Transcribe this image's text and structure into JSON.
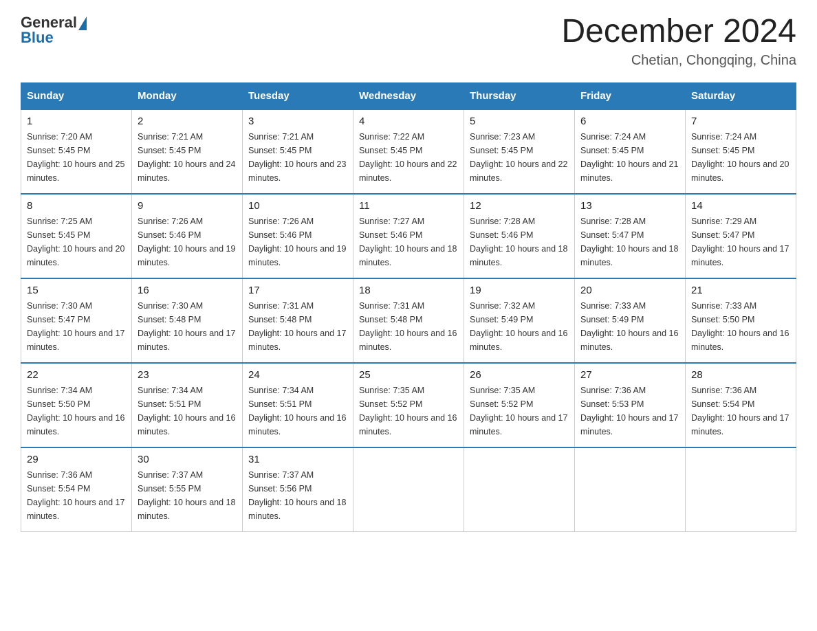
{
  "header": {
    "logo_general": "General",
    "logo_blue": "Blue",
    "month_year": "December 2024",
    "location": "Chetian, Chongqing, China"
  },
  "days_of_week": [
    "Sunday",
    "Monday",
    "Tuesday",
    "Wednesday",
    "Thursday",
    "Friday",
    "Saturday"
  ],
  "weeks": [
    [
      {
        "day": "1",
        "sunrise": "7:20 AM",
        "sunset": "5:45 PM",
        "daylight": "10 hours and 25 minutes."
      },
      {
        "day": "2",
        "sunrise": "7:21 AM",
        "sunset": "5:45 PM",
        "daylight": "10 hours and 24 minutes."
      },
      {
        "day": "3",
        "sunrise": "7:21 AM",
        "sunset": "5:45 PM",
        "daylight": "10 hours and 23 minutes."
      },
      {
        "day": "4",
        "sunrise": "7:22 AM",
        "sunset": "5:45 PM",
        "daylight": "10 hours and 22 minutes."
      },
      {
        "day": "5",
        "sunrise": "7:23 AM",
        "sunset": "5:45 PM",
        "daylight": "10 hours and 22 minutes."
      },
      {
        "day": "6",
        "sunrise": "7:24 AM",
        "sunset": "5:45 PM",
        "daylight": "10 hours and 21 minutes."
      },
      {
        "day": "7",
        "sunrise": "7:24 AM",
        "sunset": "5:45 PM",
        "daylight": "10 hours and 20 minutes."
      }
    ],
    [
      {
        "day": "8",
        "sunrise": "7:25 AM",
        "sunset": "5:45 PM",
        "daylight": "10 hours and 20 minutes."
      },
      {
        "day": "9",
        "sunrise": "7:26 AM",
        "sunset": "5:46 PM",
        "daylight": "10 hours and 19 minutes."
      },
      {
        "day": "10",
        "sunrise": "7:26 AM",
        "sunset": "5:46 PM",
        "daylight": "10 hours and 19 minutes."
      },
      {
        "day": "11",
        "sunrise": "7:27 AM",
        "sunset": "5:46 PM",
        "daylight": "10 hours and 18 minutes."
      },
      {
        "day": "12",
        "sunrise": "7:28 AM",
        "sunset": "5:46 PM",
        "daylight": "10 hours and 18 minutes."
      },
      {
        "day": "13",
        "sunrise": "7:28 AM",
        "sunset": "5:47 PM",
        "daylight": "10 hours and 18 minutes."
      },
      {
        "day": "14",
        "sunrise": "7:29 AM",
        "sunset": "5:47 PM",
        "daylight": "10 hours and 17 minutes."
      }
    ],
    [
      {
        "day": "15",
        "sunrise": "7:30 AM",
        "sunset": "5:47 PM",
        "daylight": "10 hours and 17 minutes."
      },
      {
        "day": "16",
        "sunrise": "7:30 AM",
        "sunset": "5:48 PM",
        "daylight": "10 hours and 17 minutes."
      },
      {
        "day": "17",
        "sunrise": "7:31 AM",
        "sunset": "5:48 PM",
        "daylight": "10 hours and 17 minutes."
      },
      {
        "day": "18",
        "sunrise": "7:31 AM",
        "sunset": "5:48 PM",
        "daylight": "10 hours and 16 minutes."
      },
      {
        "day": "19",
        "sunrise": "7:32 AM",
        "sunset": "5:49 PM",
        "daylight": "10 hours and 16 minutes."
      },
      {
        "day": "20",
        "sunrise": "7:33 AM",
        "sunset": "5:49 PM",
        "daylight": "10 hours and 16 minutes."
      },
      {
        "day": "21",
        "sunrise": "7:33 AM",
        "sunset": "5:50 PM",
        "daylight": "10 hours and 16 minutes."
      }
    ],
    [
      {
        "day": "22",
        "sunrise": "7:34 AM",
        "sunset": "5:50 PM",
        "daylight": "10 hours and 16 minutes."
      },
      {
        "day": "23",
        "sunrise": "7:34 AM",
        "sunset": "5:51 PM",
        "daylight": "10 hours and 16 minutes."
      },
      {
        "day": "24",
        "sunrise": "7:34 AM",
        "sunset": "5:51 PM",
        "daylight": "10 hours and 16 minutes."
      },
      {
        "day": "25",
        "sunrise": "7:35 AM",
        "sunset": "5:52 PM",
        "daylight": "10 hours and 16 minutes."
      },
      {
        "day": "26",
        "sunrise": "7:35 AM",
        "sunset": "5:52 PM",
        "daylight": "10 hours and 17 minutes."
      },
      {
        "day": "27",
        "sunrise": "7:36 AM",
        "sunset": "5:53 PM",
        "daylight": "10 hours and 17 minutes."
      },
      {
        "day": "28",
        "sunrise": "7:36 AM",
        "sunset": "5:54 PM",
        "daylight": "10 hours and 17 minutes."
      }
    ],
    [
      {
        "day": "29",
        "sunrise": "7:36 AM",
        "sunset": "5:54 PM",
        "daylight": "10 hours and 17 minutes."
      },
      {
        "day": "30",
        "sunrise": "7:37 AM",
        "sunset": "5:55 PM",
        "daylight": "10 hours and 18 minutes."
      },
      {
        "day": "31",
        "sunrise": "7:37 AM",
        "sunset": "5:56 PM",
        "daylight": "10 hours and 18 minutes."
      },
      null,
      null,
      null,
      null
    ]
  ]
}
